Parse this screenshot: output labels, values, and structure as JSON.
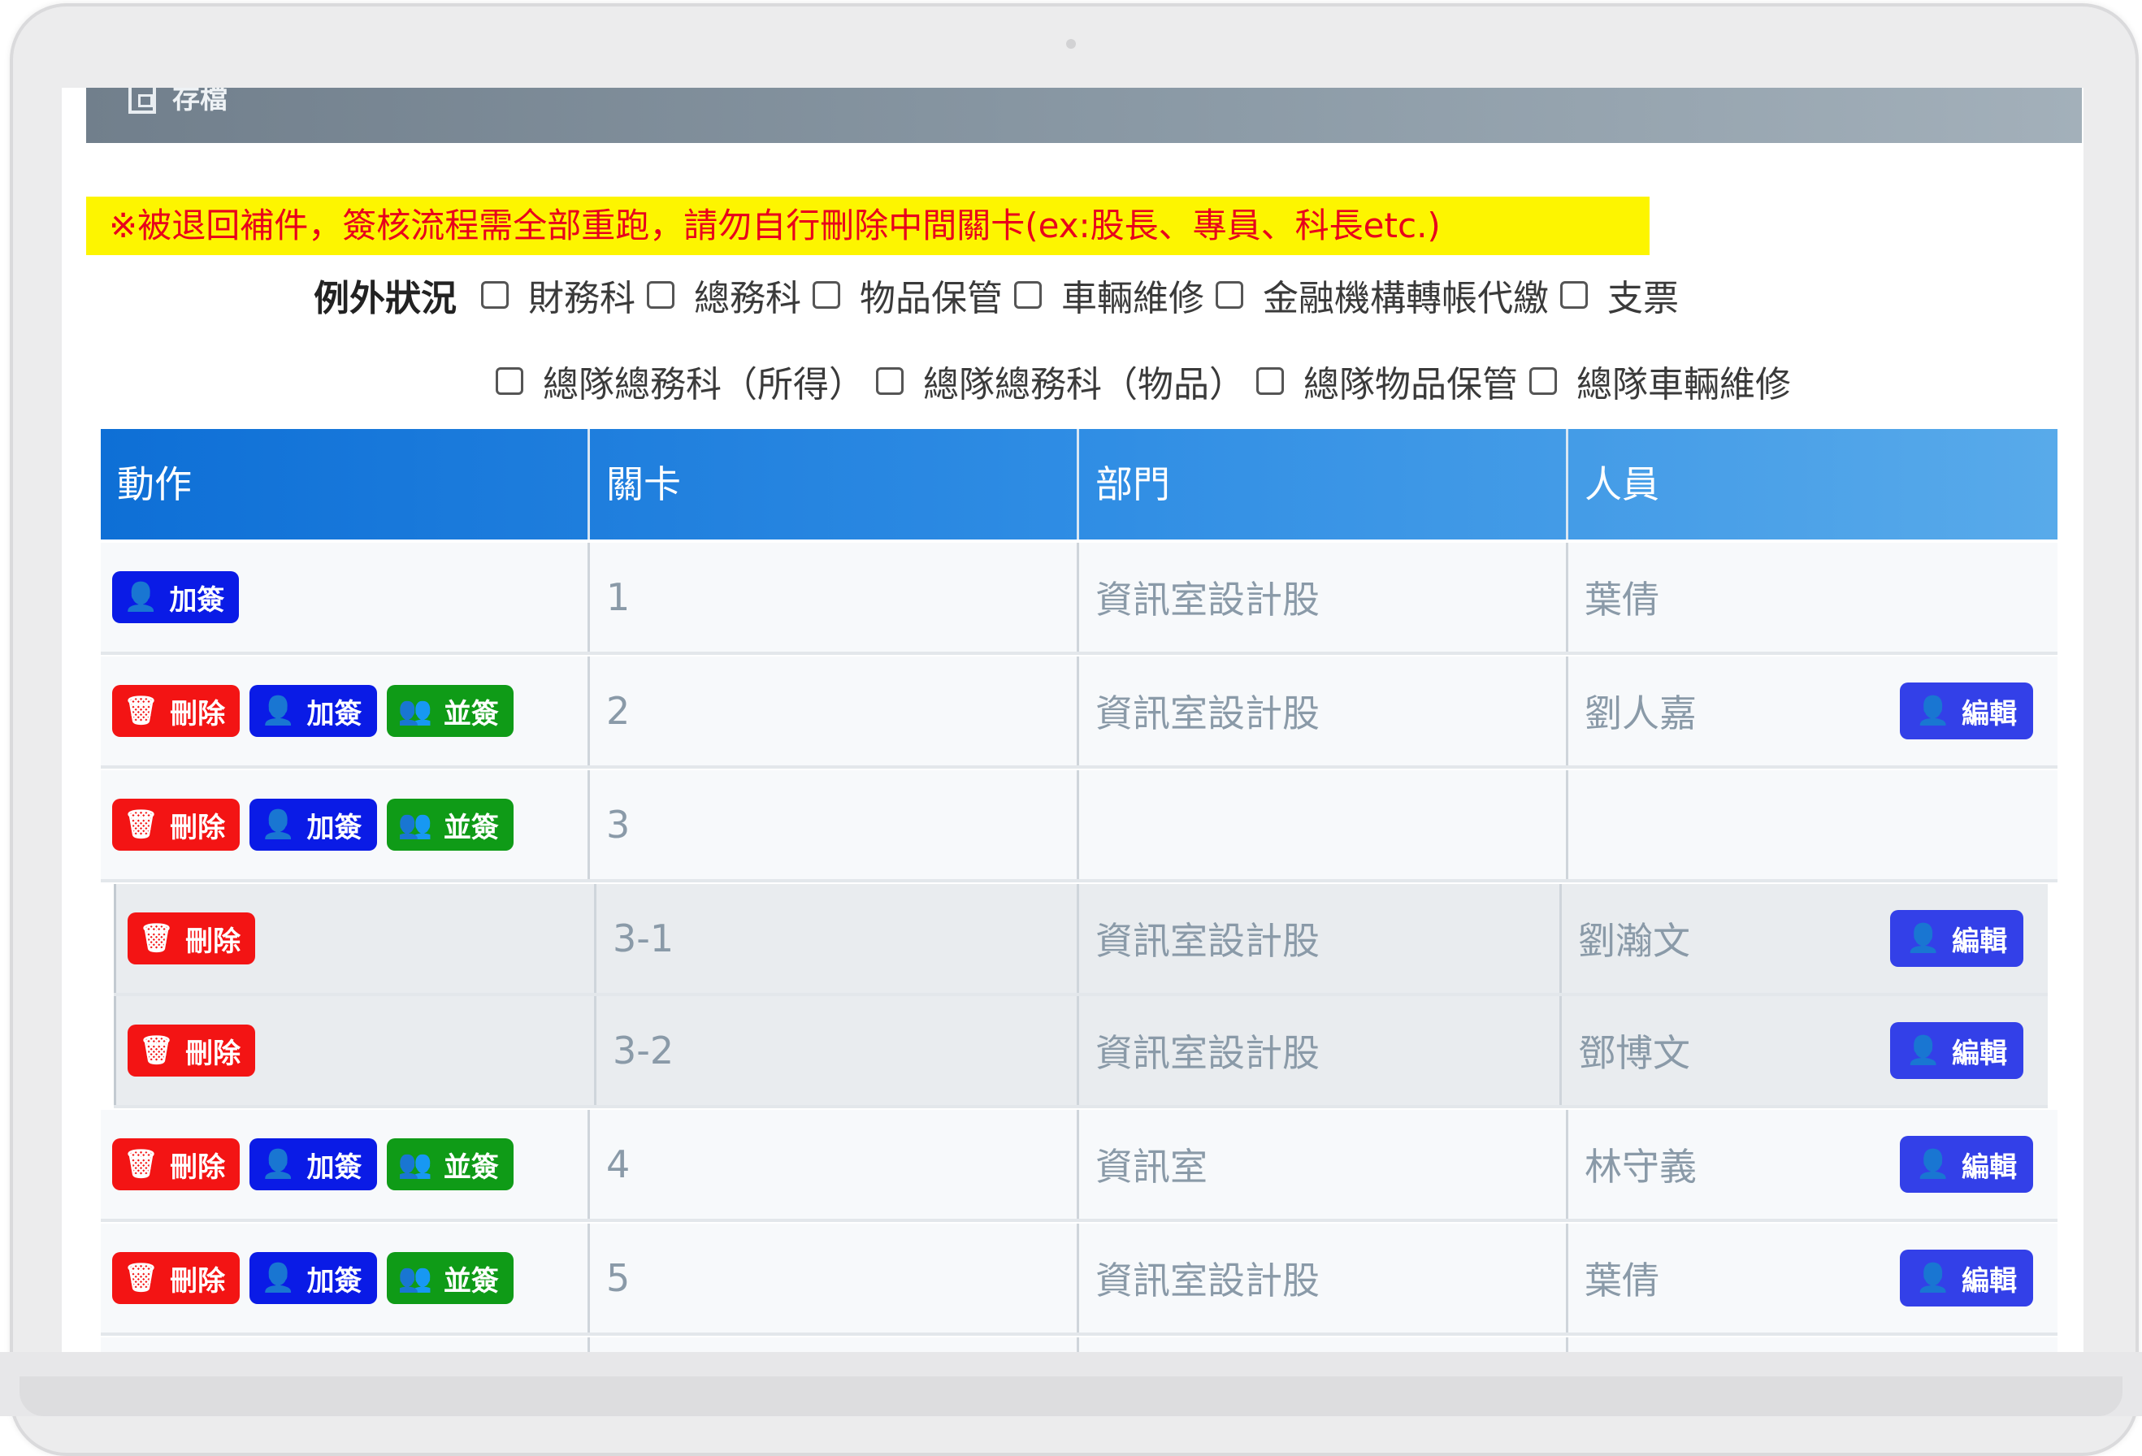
{
  "toolbar": {
    "save_label": "存檔",
    "save_icon": "save-icon"
  },
  "warning": "※被退回補件，簽核流程需全部重跑，請勿自行刪除中間關卡(ex:股長、專員、科長etc.)",
  "exceptions": {
    "title": "例外狀況",
    "row1": [
      "財務科",
      "總務科",
      "物品保管",
      "車輛維修",
      "金融機構轉帳代繳",
      "支票"
    ],
    "row2": [
      "總隊總務科（所得）",
      "總隊總務科（物品）",
      "總隊物品保管",
      "總隊車輛維修"
    ]
  },
  "table": {
    "headers": [
      "動作",
      "關卡",
      "部門",
      "人員"
    ],
    "buttons": {
      "delete": "刪除",
      "add": "加簽",
      "parallel": "並簽",
      "edit": "編輯"
    },
    "rows": [
      {
        "stage": "1",
        "dept": "資訊室設計股",
        "person": "葉倩"
      },
      {
        "stage": "2",
        "dept": "資訊室設計股",
        "person": "劉人嘉"
      },
      {
        "stage": "3",
        "dept": "",
        "person": ""
      },
      {
        "stage": "3-1",
        "dept": "資訊室設計股",
        "person": "劉瀚文"
      },
      {
        "stage": "3-2",
        "dept": "資訊室設計股",
        "person": "鄧博文"
      },
      {
        "stage": "4",
        "dept": "資訊室",
        "person": "林守義"
      },
      {
        "stage": "5",
        "dept": "資訊室設計股",
        "person": "葉倩"
      }
    ]
  },
  "colors": {
    "delete": "#f31414",
    "add": "#0a1be6",
    "parallel": "#0f9b17",
    "edit": "#3340e8",
    "header": "#1a7ad9",
    "warning_bg": "#fdf500",
    "warning_text": "#e8001c"
  }
}
